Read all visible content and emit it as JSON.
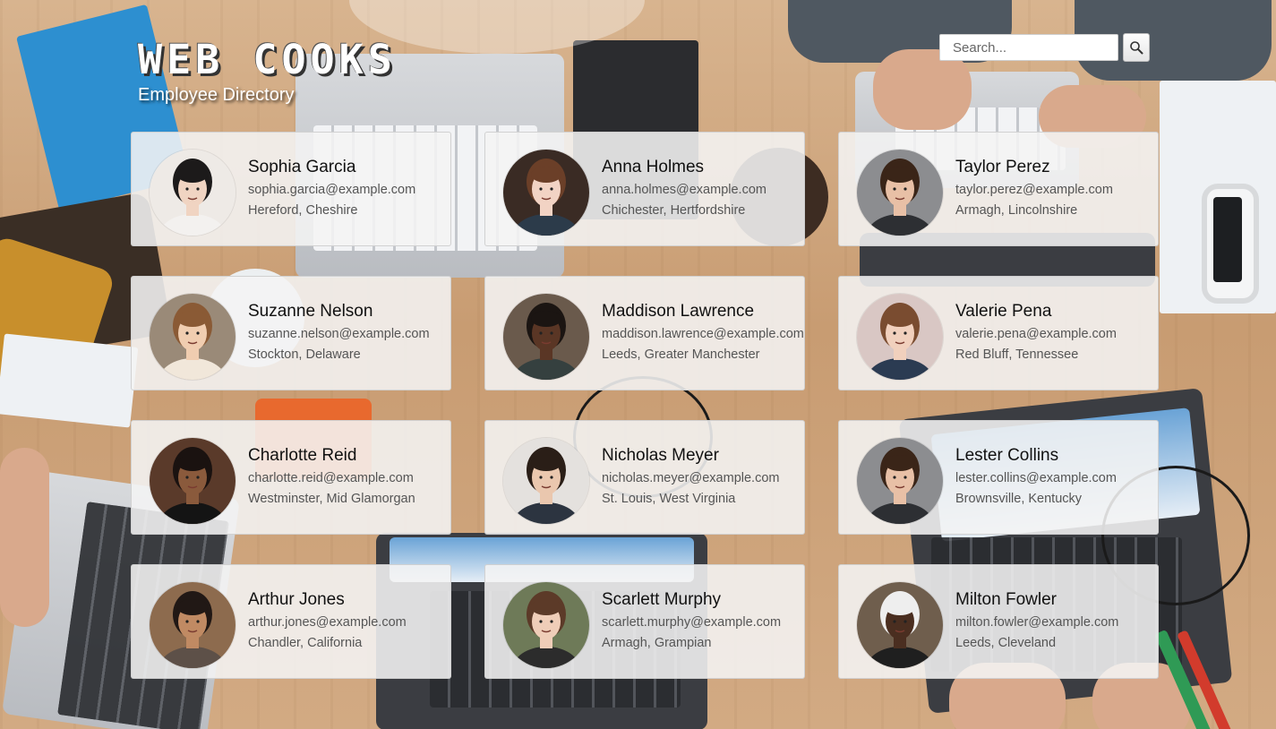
{
  "header": {
    "title": "WEB COOKS",
    "subtitle": "Employee Directory"
  },
  "search": {
    "placeholder": "Search...",
    "button_icon": "magnifier-icon"
  },
  "employees": [
    {
      "name": "Sophia Garcia",
      "email": "sophia.garcia@example.com",
      "location": "Hereford, Cheshire",
      "skin": "#f0d4c2",
      "hair": "#1c1a1a",
      "shirt": "#f3f1ef",
      "bg": "#eeeae6"
    },
    {
      "name": "Anna Holmes",
      "email": "anna.holmes@example.com",
      "location": "Chichester, Hertfordshire",
      "skin": "#f2d3c4",
      "hair": "#6b3f28",
      "shirt": "#2c3b4a",
      "bg": "#3a2b24"
    },
    {
      "name": "Taylor Perez",
      "email": "taylor.perez@example.com",
      "location": "Armagh, Lincolnshire",
      "skin": "#e8c0a6",
      "hair": "#3a2518",
      "shirt": "#2d2f33",
      "bg": "#8c8d90"
    },
    {
      "name": "Suzanne Nelson",
      "email": "suzanne.nelson@example.com",
      "location": "Stockton, Delaware",
      "skin": "#f0cdb0",
      "hair": "#8a5a35",
      "shirt": "#f1e7da",
      "bg": "#9a8a78"
    },
    {
      "name": "Maddison Lawrence",
      "email": "maddison.lawrence@example.com",
      "location": "Leeds, Greater Manchester",
      "skin": "#5a3625",
      "hair": "#1b1512",
      "shirt": "#35403f",
      "bg": "#6a5a4c"
    },
    {
      "name": "Valerie Pena",
      "email": "valerie.pena@example.com",
      "location": "Red Bluff, Tennessee",
      "skin": "#f1d0bd",
      "hair": "#7a4c30",
      "shirt": "#2b3b52",
      "bg": "#d9c7c4"
    },
    {
      "name": "Charlotte Reid",
      "email": "charlotte.reid@example.com",
      "location": "Westminster, Mid Glamorgan",
      "skin": "#8a5a3c",
      "hair": "#1a1210",
      "shirt": "#141414",
      "bg": "#5a3a2a"
    },
    {
      "name": "Nicholas Meyer",
      "email": "nicholas.meyer@example.com",
      "location": "St. Louis, West Virginia",
      "skin": "#eac7ae",
      "hair": "#2a1e17",
      "shirt": "#2c3440",
      "bg": "#e4e1de"
    },
    {
      "name": "Lester Collins",
      "email": "lester.collins@example.com",
      "location": "Brownsville, Kentucky",
      "skin": "#e8c0a6",
      "hair": "#3a2518",
      "shirt": "#2d2f33",
      "bg": "#8c8d90"
    },
    {
      "name": "Arthur Jones",
      "email": "arthur.jones@example.com",
      "location": "Chandler, California",
      "skin": "#c08a63",
      "hair": "#211815",
      "shirt": "#5d5048",
      "bg": "#8d6b4e"
    },
    {
      "name": "Scarlett Murphy",
      "email": "scarlett.murphy@example.com",
      "location": "Armagh, Grampian",
      "skin": "#efcdb8",
      "hair": "#5c3a28",
      "shirt": "#2c2c2c",
      "bg": "#6e7a58"
    },
    {
      "name": "Milton Fowler",
      "email": "milton.fowler@example.com",
      "location": "Leeds, Cleveland",
      "skin": "#4a2e20",
      "hair": "#eeeeee",
      "shirt": "#1f1f1f",
      "bg": "#6f5e4d"
    }
  ]
}
